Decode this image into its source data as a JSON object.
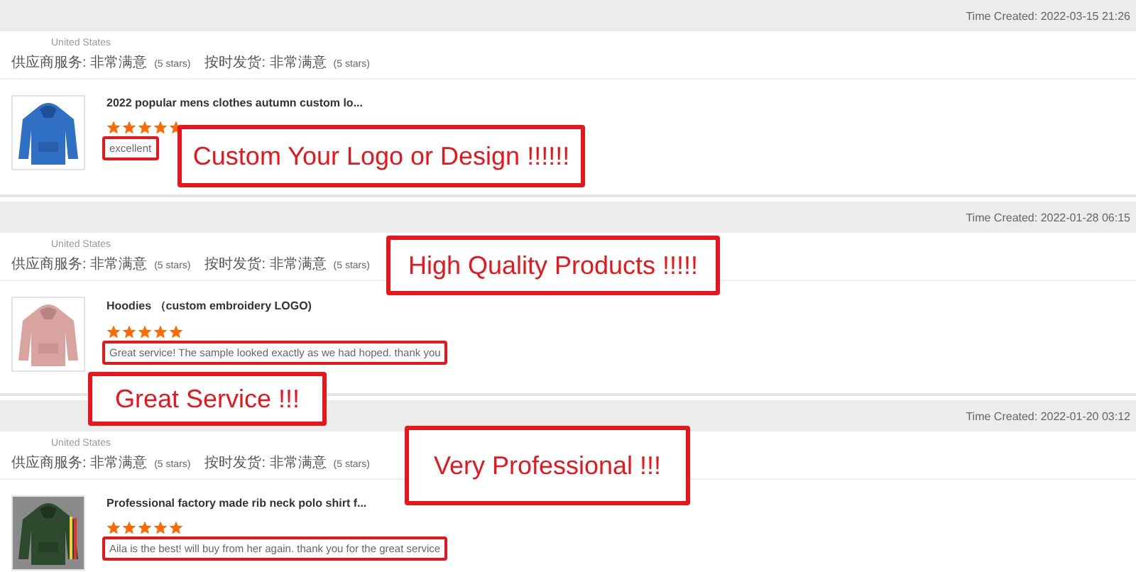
{
  "reviews": [
    {
      "time": "Time Created: 2022-03-15 21:26",
      "country": "United States",
      "ratings": [
        {
          "label": "供应商服务:",
          "value": "非常满意",
          "stars_text": "(5 stars)"
        },
        {
          "label": "按时发货:",
          "value": "非常满意",
          "stars_text": "(5 stars)"
        }
      ],
      "product": {
        "kind": "picture",
        "title": "2022 popular mens clothes autumn custom lo...",
        "stars": 5,
        "comment": "excellent",
        "highlighted": true
      }
    },
    {
      "time": "Time Created: 2022-01-28 06:15",
      "country": "United States",
      "ratings": [
        {
          "label": "供应商服务:",
          "value": "非常满意",
          "stars_text": "(5 stars)"
        },
        {
          "label": "按时发货:",
          "value": "非常满意",
          "stars_text": "(5 stars)"
        }
      ],
      "product": {
        "kind": "picture",
        "title": "Hoodies （custom embroidery LOGO)",
        "stars": 5,
        "comment": "Great service! The sample looked exactly as we had hoped. thank you",
        "highlighted": true
      }
    },
    {
      "time": "Time Created: 2022-01-20 03:12",
      "country": "United States",
      "ratings": [
        {
          "label": "供应商服务:",
          "value": "非常满意",
          "stars_text": "(5 stars)"
        },
        {
          "label": "按时发货:",
          "value": "非常满意",
          "stars_text": "(5 stars)"
        }
      ],
      "product": {
        "kind": "picture",
        "title": "Professional factory made rib neck polo shirt f...",
        "stars": 5,
        "comment": "Aila is the best! will buy from her again. thank you for the great service",
        "highlighted": true
      }
    }
  ],
  "annotations": [
    {
      "text": "Custom Your Logo or Design !!!!!!"
    },
    {
      "text": "High Quality Products !!!!!"
    },
    {
      "text": "Great Service !!!"
    },
    {
      "text": "Very Professional !!!"
    }
  ]
}
